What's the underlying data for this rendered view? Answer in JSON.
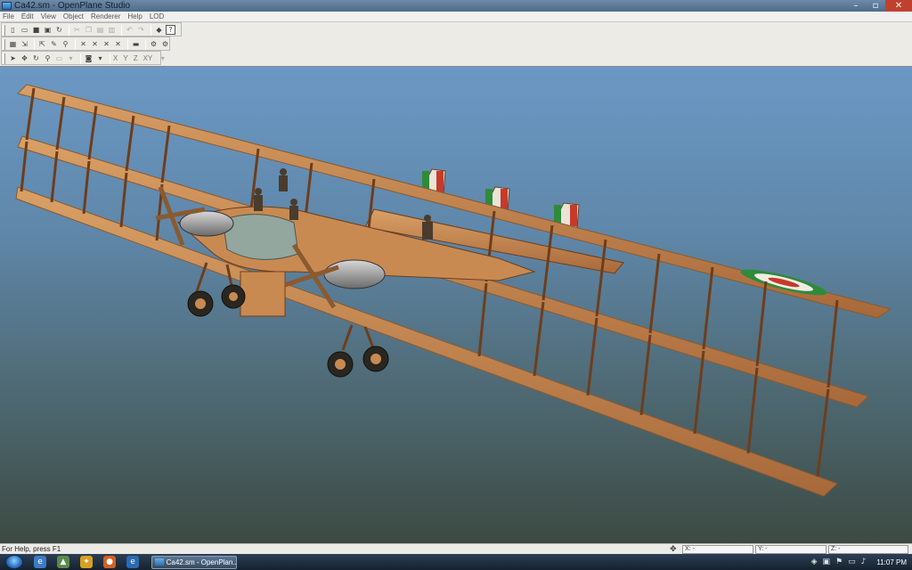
{
  "window": {
    "title": "Ca42.sm - OpenPlane Studio",
    "controls": [
      "–",
      "▫",
      "✕"
    ]
  },
  "menu": [
    "File",
    "Edit",
    "View",
    "Object",
    "Renderer",
    "Help",
    "LOD"
  ],
  "toolbar": {
    "row1": [
      "new-icon",
      "open-icon",
      "save-icon",
      "save-all-icon",
      "refresh-icon",
      "cut-icon",
      "copy-icon",
      "paste-icon",
      "print-icon",
      "undo-icon",
      "redo-icon",
      "render-icon",
      "help-icon"
    ],
    "row2": [
      "select-icon",
      "import-icon",
      "export-icon",
      "material-icon",
      "texture-icon",
      "mirror-icon",
      "scale-icon",
      "skew-icon",
      "weld-icon",
      "flatten-icon",
      "group-icon",
      "ungroup-icon"
    ],
    "row3_axes": [
      "X",
      "Y",
      "Z",
      "XY"
    ]
  },
  "status": {
    "help": "For Help, press F1",
    "x_label": "X: -",
    "y_label": "Y: -",
    "z_label": "Z: -"
  },
  "taskbar": {
    "task_label": "Ca42.sm - OpenPlan...",
    "clock": "11:07 PM"
  },
  "colors": {
    "wing": "#c98a52",
    "wing_dark": "#8a5a30",
    "strut": "#6e3d1c",
    "sky_top": "#6b98c4",
    "sky_bottom": "#3c4a42",
    "roundel_green": "#2f8a3a",
    "roundel_red": "#c73a2a"
  }
}
